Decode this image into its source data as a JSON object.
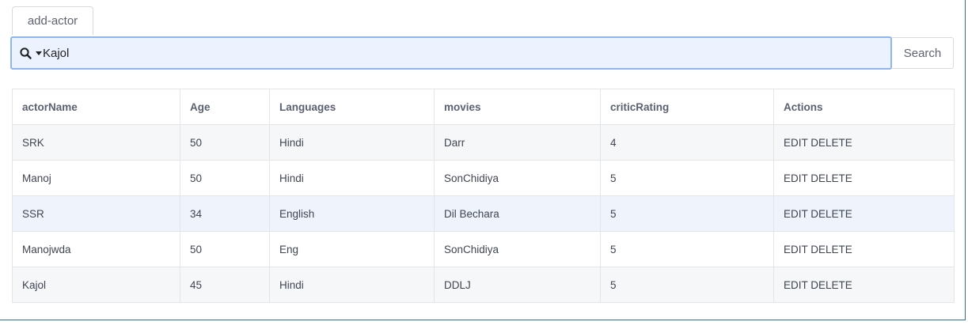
{
  "tab": {
    "label": "add-actor"
  },
  "search": {
    "value": "Kajol",
    "icon": "search-icon",
    "dropdown_icon": "caret-down-icon",
    "button_label": "Search"
  },
  "table": {
    "headers": [
      "actorName",
      "Age",
      "Languages",
      "movies",
      "criticRating",
      "Actions"
    ],
    "rows": [
      {
        "actorName": "SRK",
        "age": "50",
        "languages": "Hindi",
        "movies": "Darr",
        "criticRating": "4",
        "edit": "EDIT",
        "delete": "DELETE"
      },
      {
        "actorName": "Manoj",
        "age": "50",
        "languages": "Hindi",
        "movies": "SonChidiya",
        "criticRating": "5",
        "edit": "EDIT",
        "delete": "DELETE"
      },
      {
        "actorName": "SSR",
        "age": "34",
        "languages": "English",
        "movies": "Dil Bechara",
        "criticRating": "5",
        "edit": "EDIT",
        "delete": "DELETE"
      },
      {
        "actorName": "Manojwda",
        "age": "50",
        "languages": "Eng",
        "movies": "SonChidiya",
        "criticRating": "5",
        "edit": "EDIT",
        "delete": "DELETE"
      },
      {
        "actorName": "Kajol",
        "age": "45",
        "languages": "Hindi",
        "movies": "DDLJ",
        "criticRating": "5",
        "edit": "EDIT",
        "delete": "DELETE"
      }
    ]
  },
  "colors": {
    "focus_border": "#8fb4f2",
    "focus_bg": "#ecf3fe",
    "frame_border": "#2f6f9f"
  }
}
